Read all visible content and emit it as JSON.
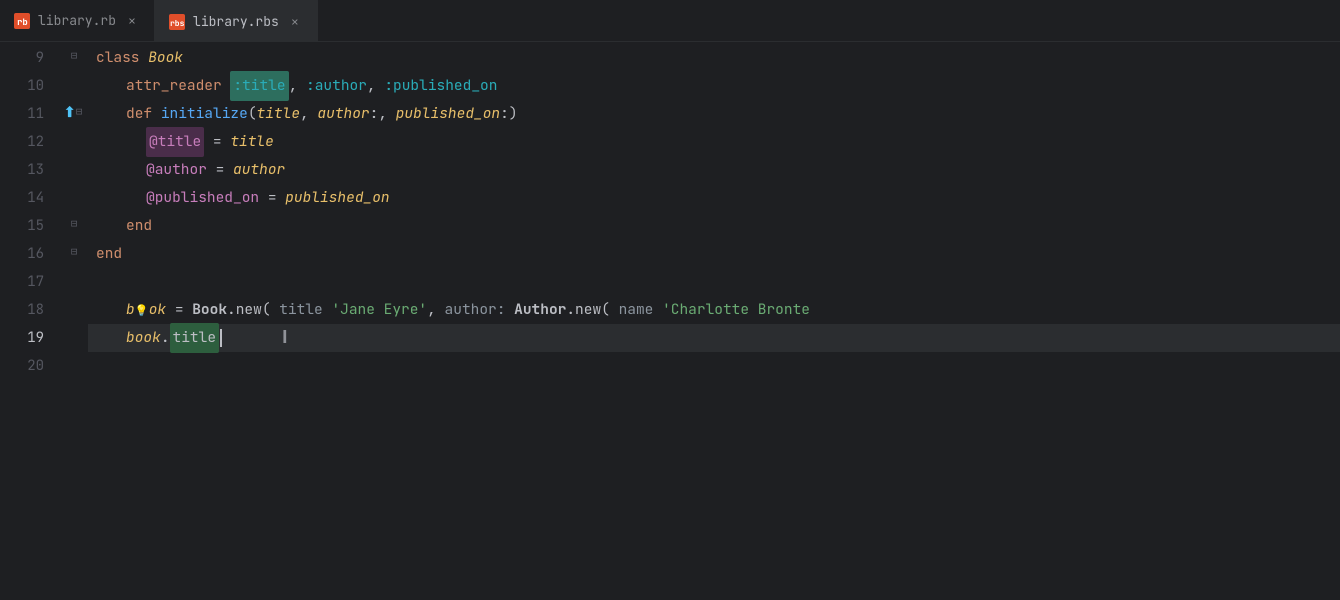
{
  "tabs": [
    {
      "id": "tab-library-rb",
      "label": "library.rb",
      "icon": "ruby-icon",
      "active": false,
      "closeable": true
    },
    {
      "id": "tab-library-rbs",
      "label": "library.rbs",
      "icon": "ruby-sig-icon",
      "active": true,
      "closeable": true
    }
  ],
  "editor": {
    "lines": [
      {
        "number": 9,
        "content": "class_Book"
      },
      {
        "number": 10,
        "content": "attr_reader"
      },
      {
        "number": 11,
        "content": "def_initialize"
      },
      {
        "number": 12,
        "content": "at_title_assign"
      },
      {
        "number": 13,
        "content": "at_author_assign"
      },
      {
        "number": 14,
        "content": "at_pub_assign"
      },
      {
        "number": 15,
        "content": "end_inner"
      },
      {
        "number": 16,
        "content": "end_outer"
      },
      {
        "number": 17,
        "content": "blank"
      },
      {
        "number": 18,
        "content": "book_assign"
      },
      {
        "number": 19,
        "content": "book_title"
      },
      {
        "number": 20,
        "content": "blank2"
      }
    ]
  },
  "colors": {
    "bg": "#1e1f22",
    "tab_active_bg": "#2b2d30",
    "line_active_bg": "#2b2d30",
    "keyword": "#cf8e6d",
    "class_name": "#e8bf6a",
    "method": "#56a8f5",
    "symbol": "#2aacb8",
    "ivar": "#c77dbb",
    "string": "#6aab73",
    "line_number": "#555760",
    "highlight_title": "#2d5e3e",
    "highlight_ivar": "#4a2d4a"
  }
}
